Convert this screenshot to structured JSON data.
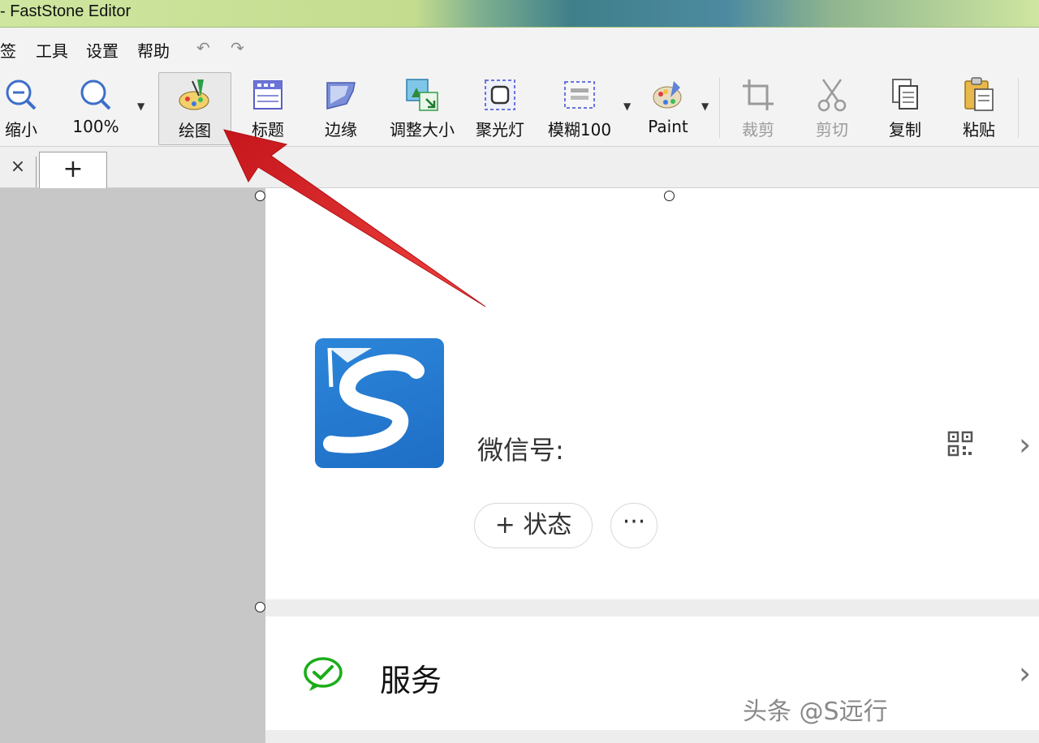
{
  "window": {
    "title": "- FastStone Editor"
  },
  "menu": {
    "items": [
      "签",
      "工具",
      "设置",
      "帮助"
    ],
    "undo": "↶",
    "redo": "↷"
  },
  "toolbar": {
    "zoom_out": "缩小",
    "zoom_level": "100%",
    "draw": "绘图",
    "caption": "标题",
    "edge": "边缘",
    "resize": "调整大小",
    "spotlight": "聚光灯",
    "blur": "模糊100",
    "paint": "Paint",
    "crop": "裁剪",
    "cut": "剪切",
    "copy": "复制",
    "paste": "粘贴"
  },
  "tabs": {
    "close": "×",
    "add": "+"
  },
  "content": {
    "wechat_id_label": "微信号:",
    "status_button": "+ 状态",
    "more_button": "···",
    "service_label": "服务",
    "chevron": "›"
  },
  "watermark": "头条 @S远行",
  "colors": {
    "arrow": "#e52421",
    "logo_blue": "#2a82d6",
    "wechat_green": "#1aad19"
  }
}
